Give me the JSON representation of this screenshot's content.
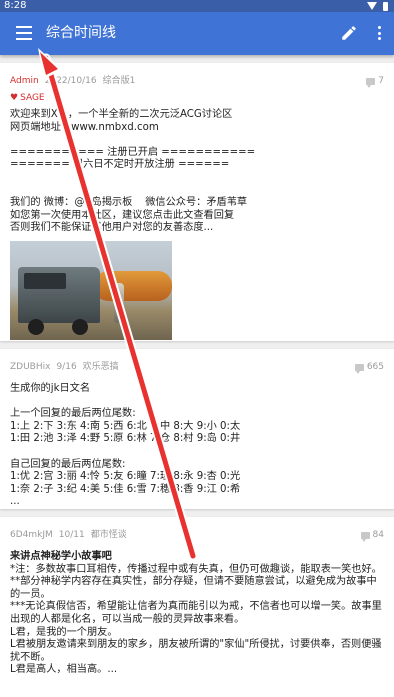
{
  "status_bar": {
    "time": "8:28"
  },
  "app_bar": {
    "title": "综合时间线",
    "icons": [
      "menu-icon",
      "pencil-icon",
      "more-vert-icon"
    ]
  },
  "colors": {
    "app_bar": "#3f73d5",
    "status_bar": "#3a5fa8",
    "admin": "#d32f2f",
    "annotation_arrow": "#e8322f"
  },
  "posts": [
    {
      "author": "Admin",
      "date": "2022/10/16",
      "board": "综合版1",
      "replies": "7",
      "sage": "SAGE",
      "lines": [
        "欢迎来到X岛，一个半全新的二次元泛ACG讨论区",
        "网页端地址：www.nmbxd.com",
        "",
        "=========== 注册已开启 ===========",
        "======= 周六日不定时开放注册 ======",
        "",
        "",
        "我们的 微博：@X岛揭示板    微信公众号：矛盾苇草",
        "如您第一次使用本社区，建议您点击此文查看回复",
        "否则我们不能保证其他用户对您的友善态度..."
      ],
      "has_image": true
    },
    {
      "author": "ZDUBHix",
      "date": "9/16",
      "board": "欢乐恶搞",
      "replies": "665",
      "lines": [
        "生成你的jk日文名",
        "",
        "上一个回复的最后两位尾数:",
        "1:上 2:下 3:东 4:南 5:西 6:北 7:中 8:大 9:小 0:太",
        "1:田 2:池 3:泽 4:野 5:原 6:林 7:仓 8:村 9:岛 0:井",
        "",
        "自己回复的最后两位尾数:",
        "1:优 2:宫 3:丽 4:怜 5:友 6:瞳 7:理 8:永 9:杏 0:光",
        "1:奈 2:子 3:纪 4:美 5:佳 6:雪 7:穗 8:香 9:江 0:希",
        "..."
      ]
    },
    {
      "author": "6D4mkJM",
      "date": "10/11",
      "board": "都市怪谈",
      "replies": "84",
      "title": "来讲点神秘学小故事吧",
      "lines": [
        "*注：多数故事口耳相传，传播过程中或有失真，但仍可做趣谈，能取表一笑也好。",
        "**部分神秘学内容存在真实性，部分存疑，但请不要随意尝试，以避免成为故事中的一员。",
        "***无论真假信否，希望能让信者为真而能引以为戒，不信者也可以增一笑。故事里出现的人都是化名，可以当成一般的灵异故事来看。",
        "L君，是我的一个朋友。",
        "L君被朋友邀请来到朋友的家乡，朋友被所谓的\"家仙\"所侵扰，讨要供奉，否则便骚扰不断。",
        "L君是高人，相当高。..."
      ]
    }
  ]
}
